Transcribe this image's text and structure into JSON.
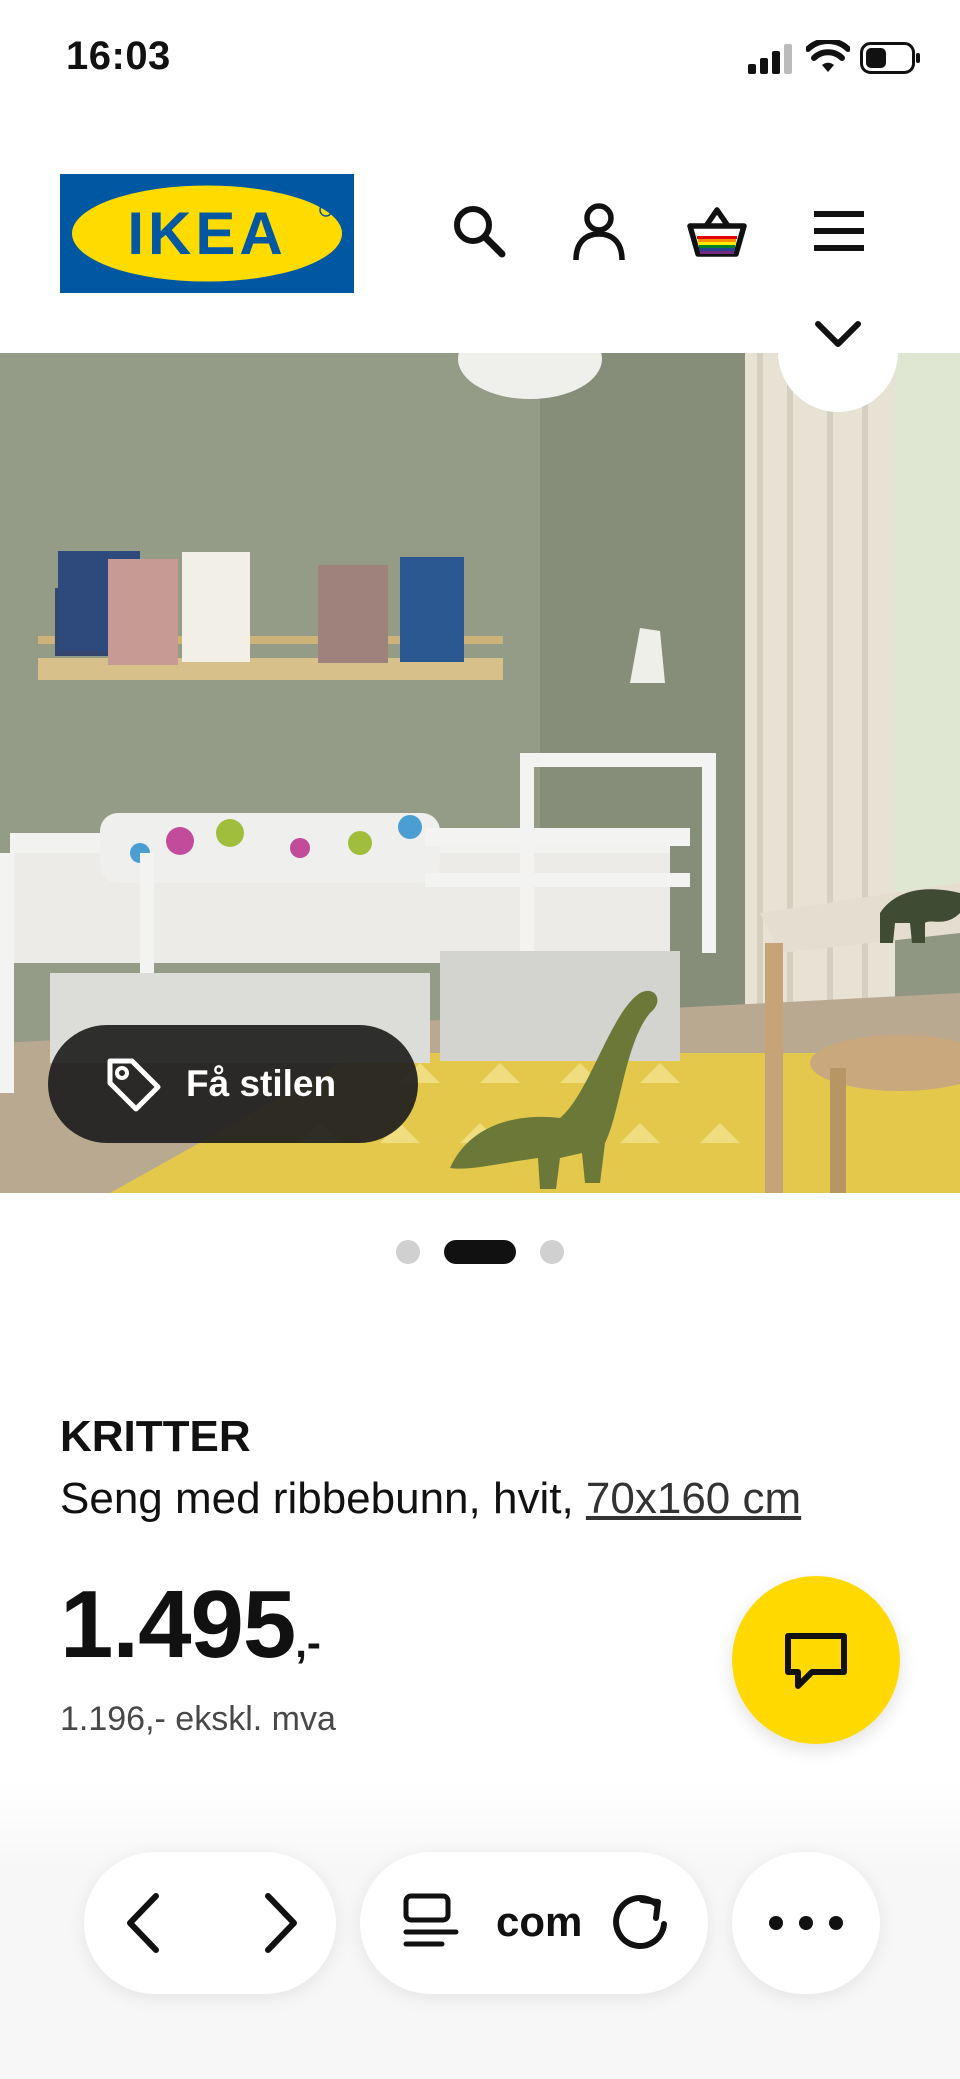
{
  "status_bar": {
    "time": "16:03"
  },
  "header": {
    "logo_text": "IKEA",
    "icons": [
      "search-icon",
      "account-icon",
      "basket-icon",
      "menu-icon"
    ]
  },
  "hero": {
    "get_style_label": "Få stilen",
    "carousel": {
      "count": 3,
      "active_index": 1
    }
  },
  "product": {
    "name": "KRITTER",
    "description": "Seng med ribbebunn, hvit,",
    "size": "70x160 cm",
    "price_main": "1.495",
    "price_suffix": ",-",
    "price_ex_vat": "1.196,- ekskl. mva"
  },
  "browser": {
    "url_fragment": "com"
  },
  "colors": {
    "ikea_blue": "#0058a3",
    "ikea_yellow": "#ffdb00",
    "chat_yellow": "#ffd900"
  }
}
